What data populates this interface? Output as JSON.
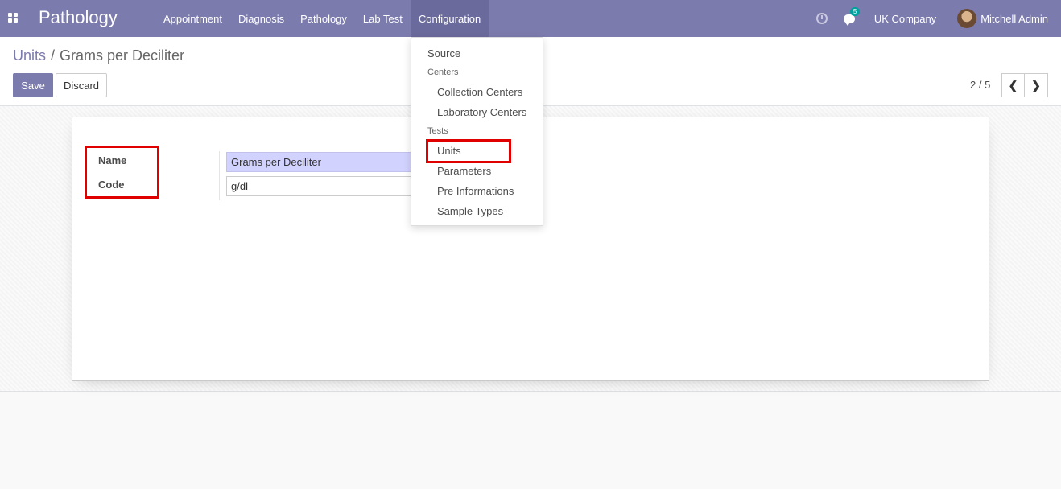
{
  "navbar": {
    "brand": "Pathology",
    "menu": [
      "Appointment",
      "Diagnosis",
      "Pathology",
      "Lab Test",
      "Configuration"
    ],
    "active_menu": "Configuration",
    "chat_count": "5",
    "company": "UK Company",
    "user": "Mitchell Admin"
  },
  "breadcrumb": {
    "parent": "Units",
    "separator": "/",
    "current": "Grams per Deciliter"
  },
  "toolbar": {
    "save_label": "Save",
    "discard_label": "Discard",
    "pager_value": "2 / 5"
  },
  "form": {
    "name_label": "Name",
    "name_value": "Grams per Deciliter",
    "code_label": "Code",
    "code_value": "g/dl"
  },
  "dropdown": {
    "source": "Source",
    "centers_header": "Centers",
    "collection_centers": "Collection Centers",
    "laboratory_centers": "Laboratory Centers",
    "tests_header": "Tests",
    "units": "Units",
    "parameters": "Parameters",
    "pre_informations": "Pre Informations",
    "sample_types": "Sample Types"
  },
  "colors": {
    "primary": "#7c7bad",
    "highlight": "#e00000",
    "badge": "#00a09d"
  }
}
